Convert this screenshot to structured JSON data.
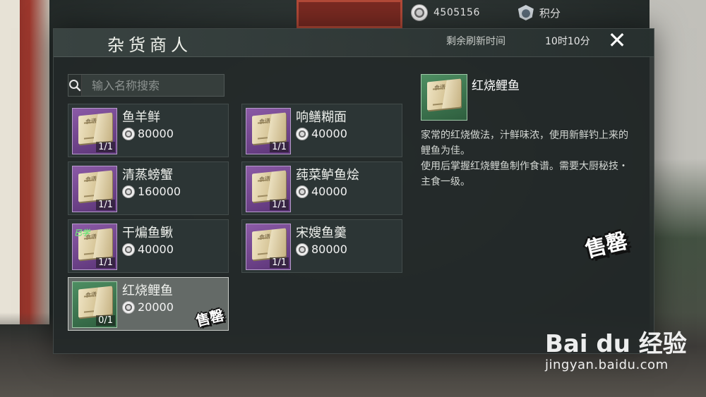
{
  "currency": {
    "amount": "4505156",
    "icon": "coin-icon"
  },
  "points": {
    "label": "积分",
    "icon": "points-badge-icon"
  },
  "shop": {
    "title": "杂货商人",
    "refresh_label": "剩余刷新时间",
    "refresh_time": "10时10分",
    "close_label": "✕"
  },
  "search": {
    "placeholder": "输入名称搜索",
    "value": ""
  },
  "items": [
    {
      "name": "鱼羊鲜",
      "price": "80000",
      "stock": "1/1",
      "rarity": "purple"
    },
    {
      "name": "响鳝糊面",
      "price": "40000",
      "stock": "1/1",
      "rarity": "purple"
    },
    {
      "name": "清蒸螃蟹",
      "price": "160000",
      "stock": "1/1",
      "rarity": "purple"
    },
    {
      "name": "莼菜鲈鱼烩",
      "price": "40000",
      "stock": "1/1",
      "rarity": "purple"
    },
    {
      "name": "干煸鱼鳅",
      "price": "40000",
      "stock": "1/1",
      "rarity": "purple",
      "badge": "已学"
    },
    {
      "name": "宋嫂鱼羹",
      "price": "80000",
      "stock": "1/1",
      "rarity": "purple"
    },
    {
      "name": "红烧鲤鱼",
      "price": "20000",
      "stock": "0/1",
      "rarity": "green",
      "stamp": "售罄"
    }
  ],
  "detail": {
    "name": "红烧鲤鱼",
    "description_line1": "家常的红烧做法，汁鲜味浓，使用新鲜钓上来的鲤鱼为佳。",
    "description_line2": "使用后掌握红烧鲤鱼制作食谱。需要大厨秘技・主食一级。",
    "stamp": "售罄"
  },
  "book_tag": "食谱",
  "watermark": {
    "logo": "Bai du 经验",
    "url": "jingyan.baidu.com"
  },
  "colors": {
    "purple_rarity": "#6b3f8a",
    "green_rarity": "#3e7a50",
    "learned": "#6fe07a"
  }
}
